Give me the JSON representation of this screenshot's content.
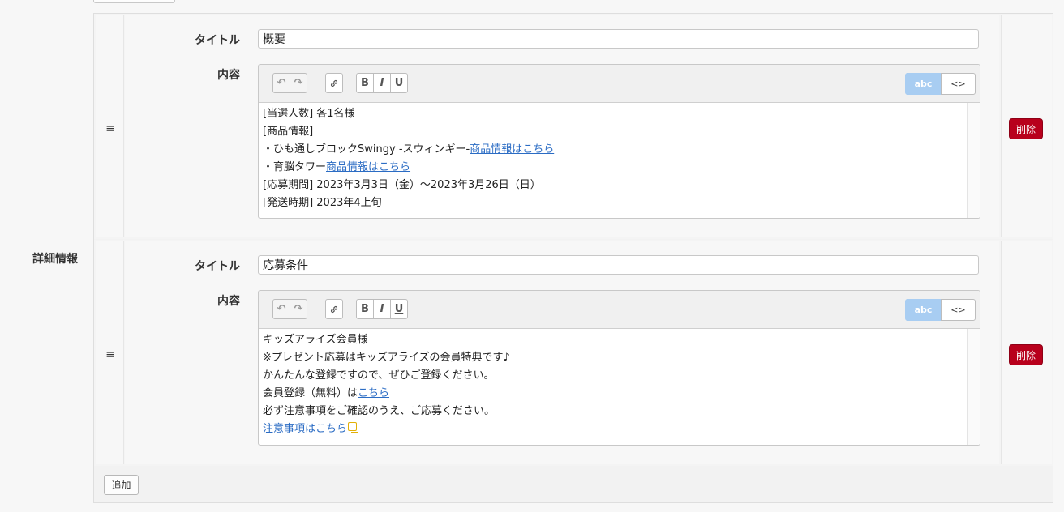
{
  "section": {
    "label": "詳細情報"
  },
  "items": [
    {
      "title_label": "タイトル",
      "title_value": "概要",
      "content_label": "内容",
      "toolbar": {
        "undo": "↶",
        "redo": "↷",
        "link": "🔗",
        "bold": "B",
        "italic": "I",
        "underline": "U",
        "mode_rich": "abc",
        "mode_code": "<>"
      },
      "content_lines": [
        {
          "text": "[当選人数] 各1名様",
          "link": ""
        },
        {
          "text": "[商品情報]",
          "link": ""
        },
        {
          "text": "・ひも通しブロックSwingy -スウィンギー-",
          "link": "商品情報はこちら"
        },
        {
          "text": "・育脳タワー",
          "link": "商品情報はこちら"
        },
        {
          "text": "[応募期間] 2023年3月3日（金）〜2023年3月26日（日）",
          "link": ""
        },
        {
          "text": "[発送時期] 2023年4上旬",
          "link": ""
        }
      ],
      "delete_label": "削除",
      "drag_icon": "≡"
    },
    {
      "title_label": "タイトル",
      "title_value": "応募条件",
      "content_label": "内容",
      "toolbar": {
        "undo": "↶",
        "redo": "↷",
        "link": "🔗",
        "bold": "B",
        "italic": "I",
        "underline": "U",
        "mode_rich": "abc",
        "mode_code": "<>"
      },
      "content_lines": [
        {
          "text": "キッズアライズ会員様",
          "link": ""
        },
        {
          "text": "※プレゼント応募はキッズアライズの会員特典です♪",
          "link": ""
        },
        {
          "text": "かんたんな登録ですので、ぜひご登録ください。",
          "link": ""
        },
        {
          "text": "会員登録（無料）は",
          "link": "こちら"
        },
        {
          "text": "必ず注意事項をご確認のうえ、ご応募ください。",
          "link": ""
        },
        {
          "text": "",
          "link": "注意事項はこちら",
          "external": true
        }
      ],
      "delete_label": "削除",
      "drag_icon": "≡"
    }
  ],
  "add_button_label": "追加",
  "colors": {
    "delete": "#b8001c",
    "link": "#2b6cc4",
    "mode_active": "#a8cdf2",
    "external_icon": "#e2b007"
  }
}
